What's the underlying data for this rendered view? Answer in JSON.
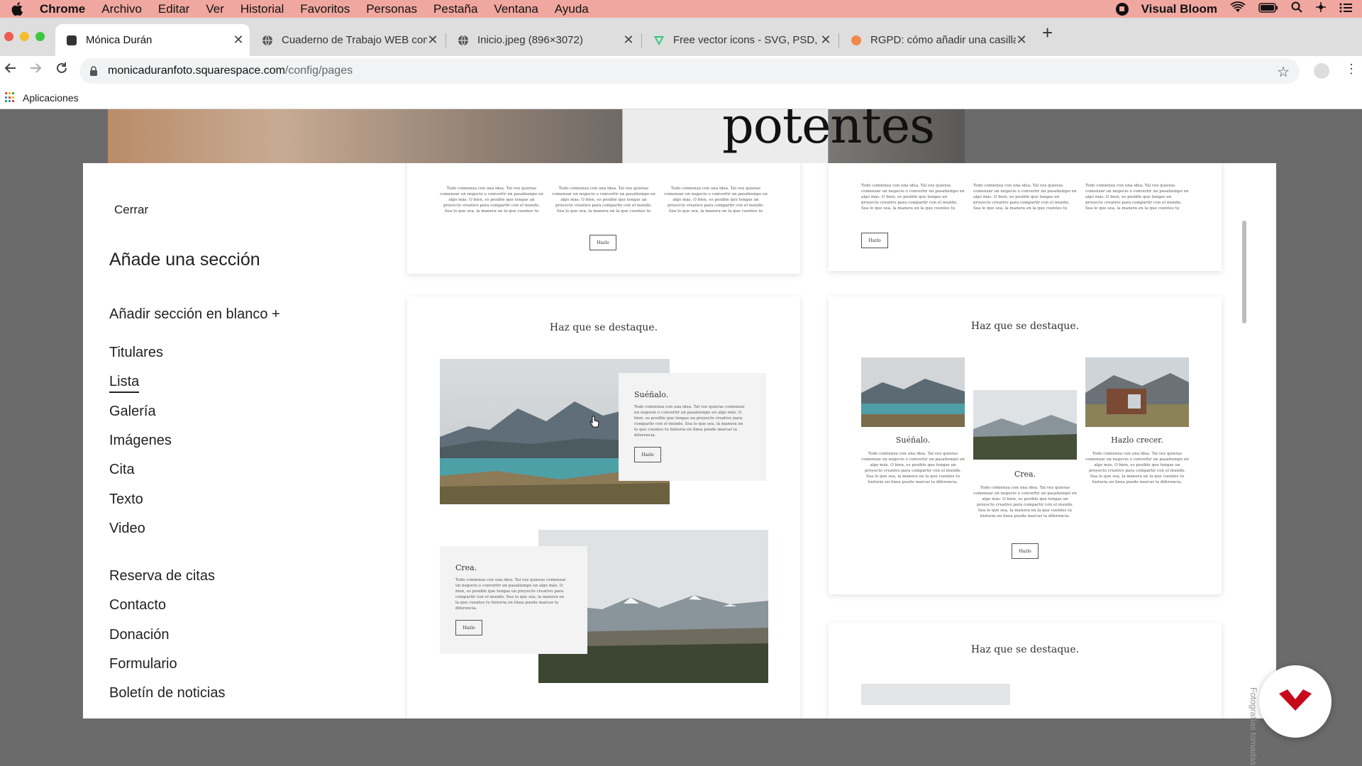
{
  "menubar": {
    "app": "Chrome",
    "items": [
      "Archivo",
      "Editar",
      "Ver",
      "Historial",
      "Favoritos",
      "Personas",
      "Pestaña",
      "Ventana",
      "Ayuda"
    ],
    "status_app": "Visual Bloom"
  },
  "tabs": [
    {
      "title": "Mónica Durán",
      "active": true
    },
    {
      "title": "Cuaderno de Trabajo WEB com",
      "active": false
    },
    {
      "title": "Inicio.jpeg (896×3072)",
      "active": false
    },
    {
      "title": "Free vector icons - SVG, PSD, I",
      "active": false
    },
    {
      "title": "RGPD: cómo añadir una casilla",
      "active": false
    }
  ],
  "address": {
    "host": "monicaduranfoto.squarespace.com",
    "path": "/config/pages"
  },
  "bookmarks": {
    "apps_label": "Aplicaciones"
  },
  "hero": {
    "word": "potentes"
  },
  "panel": {
    "close_label": "Cerrar",
    "title": "Añade una sección",
    "blank_label": "Añadir sección en blanco +",
    "categories_a": [
      "Titulares",
      "Lista",
      "Galería",
      "Imágenes",
      "Cita",
      "Texto",
      "Video"
    ],
    "categories_b": [
      "Reserva de citas",
      "Contacto",
      "Donación",
      "Formulario",
      "Boletín de noticias"
    ],
    "selected_category": "Lista"
  },
  "previews": {
    "body_text": "Todo comienza con una idea. Tal vez quieras comenzar un negocio o convertir un pasatiempo en algo más. O bien, es posible que tengas un proyecto creativo para compartir con el mundo. Sea lo que sea, la manera en la que cuentes tu historia en línea puede marcar la diferencia.",
    "button": "Hazlo",
    "heading": "Haz que se destaque.",
    "item1": "Suéñalo.",
    "item2": "Crea.",
    "item3": "Hazlo crecer."
  },
  "credit": "Fotografías tomadas en A",
  "colors": {
    "menubar": "#f0a79f",
    "accent_red": "#c7091b"
  }
}
